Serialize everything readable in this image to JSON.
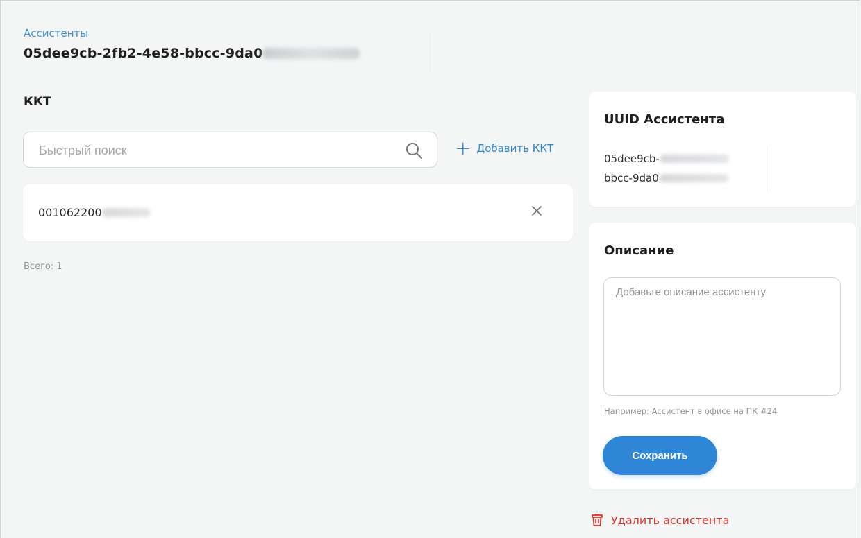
{
  "breadcrumb": {
    "parent": "Ассистенты"
  },
  "page": {
    "title_visible": "05dee9cb-2fb2-4e58-bbcc-9da0"
  },
  "kkt_section": {
    "title": "ККТ",
    "search": {
      "placeholder": "Быстрый поиск",
      "value": ""
    },
    "add_label": "Добавить ККТ",
    "items": [
      {
        "value_visible": "001062200"
      }
    ],
    "total_label": "Всего: 1"
  },
  "uuid_card": {
    "title": "UUID Ассистента",
    "line1_visible": "05dee9cb-",
    "line2_visible": "bbcc-9da0"
  },
  "description_card": {
    "title": "Описание",
    "textarea": {
      "placeholder": "Добавьте описание ассистенту",
      "value": ""
    },
    "hint": "Например: Ассистент в офисе на ПК #24",
    "save_label": "Сохранить"
  },
  "delete_label": "Удалить ассистента",
  "icons": {
    "search": "search-icon",
    "add": "plus-icon",
    "remove": "close-icon",
    "delete": "trash-icon"
  },
  "colors": {
    "accent": "#2f86d6",
    "link": "#3d8ed6",
    "danger": "#d9342b",
    "background": "#f4f6f6",
    "card": "#ffffff"
  }
}
